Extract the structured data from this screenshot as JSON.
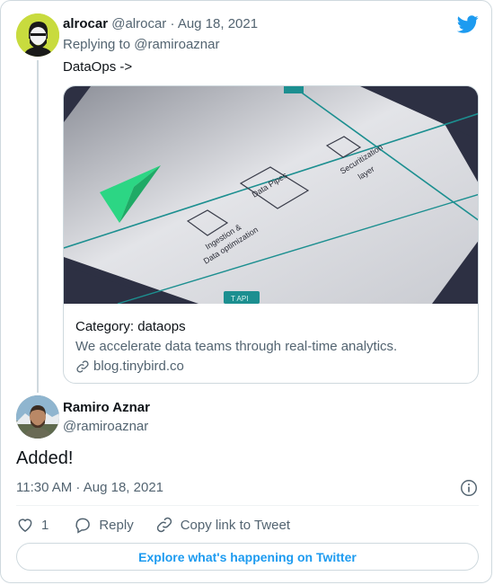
{
  "parent": {
    "name": "alrocar",
    "handle": "@alrocar",
    "separator": "·",
    "date": "Aug 18, 2021",
    "replying_prefix": "Replying to",
    "replying_handle": "@ramiroaznar",
    "text": "DataOps ->"
  },
  "link_card": {
    "image_labels": {
      "ingestion": [
        "Ingestion &",
        "Data optimization"
      ],
      "pipes": "Data Pipes",
      "security": [
        "Securitization",
        "layer"
      ],
      "api": "T API"
    },
    "title": "Category: dataops",
    "description": "We accelerate data teams through real-time analytics.",
    "domain": "blog.tinybird.co"
  },
  "tweet": {
    "name": "Ramiro Aznar",
    "handle": "@ramiroaznar",
    "text": "Added!",
    "timestamp": "11:30 AM · Aug 18, 2021"
  },
  "actions": {
    "like_count": "1",
    "reply_label": "Reply",
    "copy_label": "Copy link to Tweet"
  },
  "explore_label": "Explore what's happening on Twitter",
  "colors": {
    "twitter_blue": "#1d9bf0",
    "secondary_text": "#536471",
    "border": "#cfd9de"
  }
}
